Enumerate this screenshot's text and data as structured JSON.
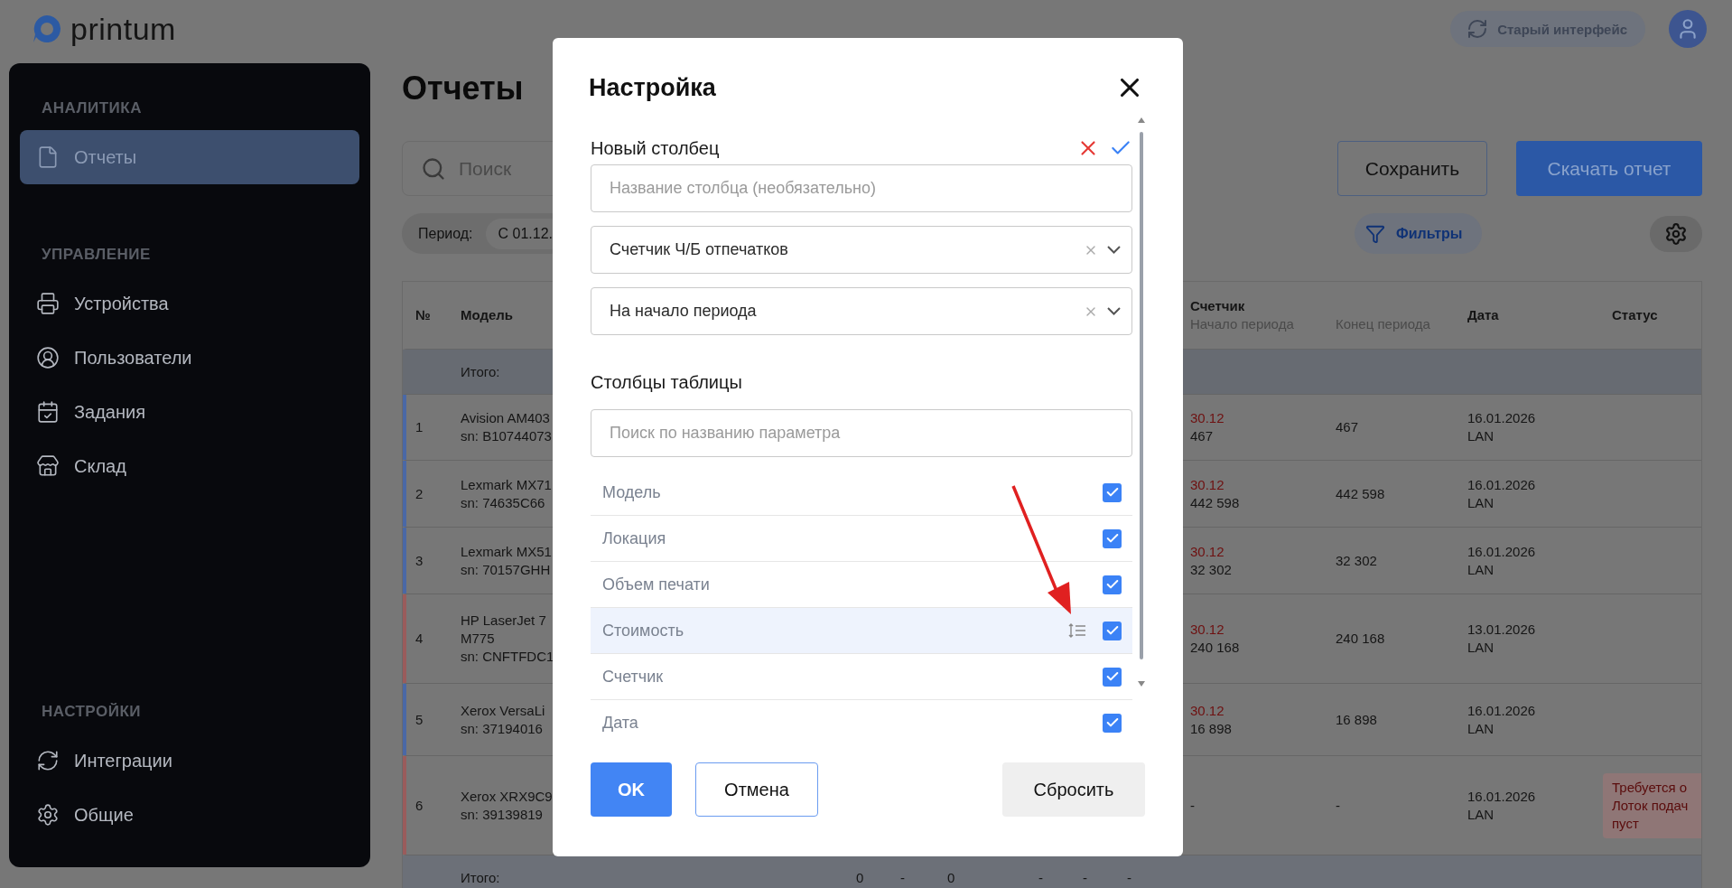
{
  "header": {
    "logo": "printum",
    "old_ui": "Старый интерфейс"
  },
  "sidebar": {
    "sections": [
      {
        "title": "АНАЛИТИКА",
        "items": [
          {
            "label": "Отчеты",
            "selected": true
          }
        ]
      },
      {
        "title": "УПРАВЛЕНИЕ",
        "items": [
          {
            "label": "Устройства",
            "selected": false
          },
          {
            "label": "Пользователи",
            "selected": false
          },
          {
            "label": "Задания",
            "selected": false
          },
          {
            "label": "Склад",
            "selected": false
          }
        ]
      },
      {
        "title": "НАСТРОЙКИ",
        "items": [
          {
            "label": "Интеграции",
            "selected": false
          },
          {
            "label": "Общие",
            "selected": false
          }
        ]
      }
    ]
  },
  "page": {
    "title": "Отчеты",
    "search_placeholder": "Поиск",
    "save": "Сохранить",
    "download": "Скачать отчет",
    "period_label": "Период:",
    "period_value": "С 01.12.",
    "filters": "Фильтры"
  },
  "table": {
    "columns": {
      "num": "№",
      "model": "Модель",
      "counter": "Счетчик",
      "start": "Начало периода",
      "end": "Конец периода",
      "date": "Дата",
      "status": "Статус"
    },
    "total_label": "Итого:",
    "rows": [
      {
        "num": "1",
        "model": [
          "Avision AM403",
          "sn: B10744073"
        ],
        "color": "#4a68a6",
        "start_date": "30.12",
        "start": "467",
        "end": "467",
        "date": "16.01.2026",
        "conn": "LAN",
        "status": []
      },
      {
        "num": "2",
        "model": [
          "Lexmark MX71",
          "sn: 74635C66"
        ],
        "color": "#4a68a6",
        "start_date": "30.12",
        "start": "442 598",
        "end": "442 598",
        "date": "16.01.2026",
        "conn": "LAN",
        "status": []
      },
      {
        "num": "3",
        "model": [
          "Lexmark MX51",
          "sn: 70157GHH"
        ],
        "color": "#4a68a6",
        "start_date": "30.12",
        "start": "32 302",
        "end": "32 302",
        "date": "16.01.2026",
        "conn": "LAN",
        "status": []
      },
      {
        "num": "4",
        "model": [
          "HP LaserJet 7",
          "M775",
          "sn: CNFTFDC1"
        ],
        "color": "#9a5c5c",
        "start_date": "30.12",
        "start": "240 168",
        "end": "240 168",
        "date": "13.01.2026",
        "conn": "LAN",
        "status": []
      },
      {
        "num": "5",
        "model": [
          "Xerox VersaLi",
          "sn: 37194016"
        ],
        "color": "#4a68a6",
        "start_date": "30.12",
        "start": "16 898",
        "end": "16 898",
        "date": "16.01.2026",
        "conn": "LAN",
        "status": []
      },
      {
        "num": "6",
        "model": [
          "Xerox XRX9C9",
          "sn: 39139819"
        ],
        "color": "#9a5c5c",
        "start_date": "",
        "start": "-",
        "end": "-",
        "date": "16.01.2026",
        "conn": "LAN",
        "status": [
          "Требуется о",
          "Лоток подач",
          "пуст"
        ]
      }
    ],
    "footer": {
      "label": "Итого:",
      "values": [
        "0",
        "-",
        "0",
        "-",
        "-",
        "-"
      ]
    }
  },
  "dialog": {
    "title": "Настройка",
    "new_column": "Новый столбец",
    "name_placeholder": "Название столбца (необязательно)",
    "selects": [
      "Счетчик Ч/Б отпечатков",
      "На начало периода"
    ],
    "columns_title": "Столбцы таблицы",
    "search_placeholder": "Поиск по названию параметра",
    "columns": [
      {
        "label": "Модель",
        "checked": true,
        "hovered": false
      },
      {
        "label": "Локация",
        "checked": true,
        "hovered": false
      },
      {
        "label": "Объем печати",
        "checked": true,
        "hovered": false
      },
      {
        "label": "Стоимость",
        "checked": true,
        "hovered": true
      },
      {
        "label": "Счетчик",
        "checked": true,
        "hovered": false
      },
      {
        "label": "Дата",
        "checked": true,
        "hovered": false
      }
    ],
    "ok": "OK",
    "cancel": "Отмена",
    "reset": "Сбросить"
  }
}
